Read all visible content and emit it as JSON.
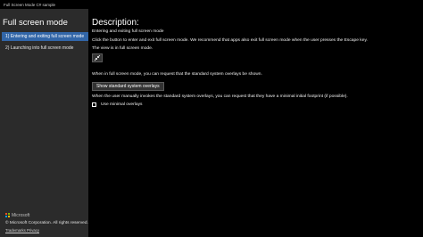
{
  "window": {
    "title": "Full Screen Mode C# sample"
  },
  "sidebar": {
    "heading": "Full screen mode",
    "scenarios": [
      {
        "label": "1) Entering and exiting full screen mode",
        "selected": true
      },
      {
        "label": "2) Launching into full screen mode",
        "selected": false
      }
    ],
    "footer": {
      "brand": "Microsoft",
      "copyright": "© Microsoft Corporation. All rights reserved.",
      "links": "Trademarks Privacy"
    },
    "logo_colors": [
      "#f25022",
      "#7fba00",
      "#00a4ef",
      "#ffb900"
    ]
  },
  "main": {
    "title": "Description:",
    "scenario_name": "Entering and exiting full screen mode",
    "instructions": "Click the button to enter and exit full screen mode. We recommend that apps also exit full screen mode when the user presses the Escape key.",
    "status": "The view is in full screen mode.",
    "toggle_button_icon": "collapse-arrows-icon",
    "overlay_intro": "When in full screen mode, you can request that the standard system overlays be shown.",
    "show_overlays_button": "Show standard system overlays",
    "minimal_intro": "When the user manually invokes the standard system overlays, you can request that they have a minimal initial footprint (if possible).",
    "minimal_checkbox_label": "Use minimal overlays",
    "minimal_checked": false
  },
  "colors": {
    "accent": "#3266a8",
    "sidebar_bg": "#2b2b2b",
    "background": "#000000"
  }
}
